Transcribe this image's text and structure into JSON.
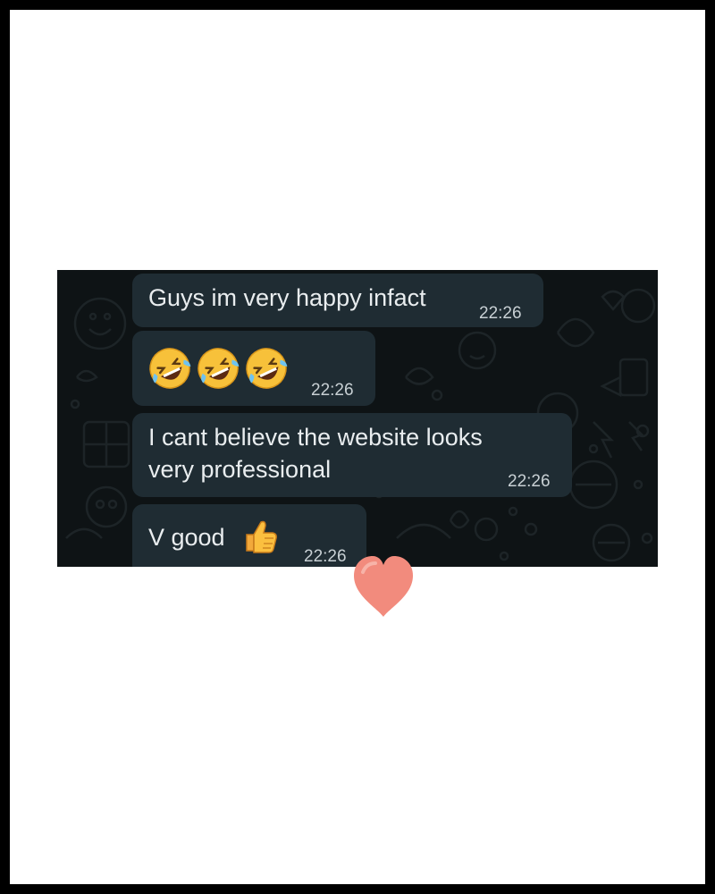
{
  "chat": {
    "background_color": "#0e1315",
    "bubble_color": "#1f2c33",
    "messages": [
      {
        "id": "m1",
        "text": "Guys im very happy infact",
        "time": "22:26"
      },
      {
        "id": "m2",
        "emoji": [
          "rolling-on-floor-laughing",
          "rolling-on-floor-laughing",
          "rolling-on-floor-laughing"
        ],
        "time": "22:26"
      },
      {
        "id": "m3",
        "lines": [
          "I cant believe the website looks",
          "very professional"
        ],
        "time": "22:26"
      },
      {
        "id": "m4",
        "text": "V good",
        "emoji": "thumbs-up",
        "time": "22:26"
      }
    ]
  },
  "reaction": {
    "icon": "heart-icon",
    "color": "#f28b7d"
  }
}
